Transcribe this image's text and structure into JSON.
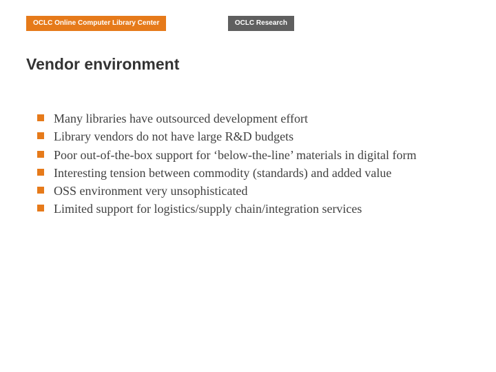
{
  "header": {
    "badge_left": "OCLC Online Computer Library Center",
    "badge_right": "OCLC Research"
  },
  "title": "Vendor environment",
  "bullets": [
    "Many libraries have outsourced development effort",
    "Library vendors do not have large R&D budgets",
    "Poor out-of-the-box support for ‘below-the-line’ materials in digital form",
    "Interesting tension between commodity (standards) and added value",
    "OSS environment very unsophisticated",
    "Limited support for logistics/supply chain/integration services"
  ],
  "colors": {
    "accent": "#e67a1a",
    "badge_secondary": "#5f5f5f",
    "text": "#333333"
  }
}
